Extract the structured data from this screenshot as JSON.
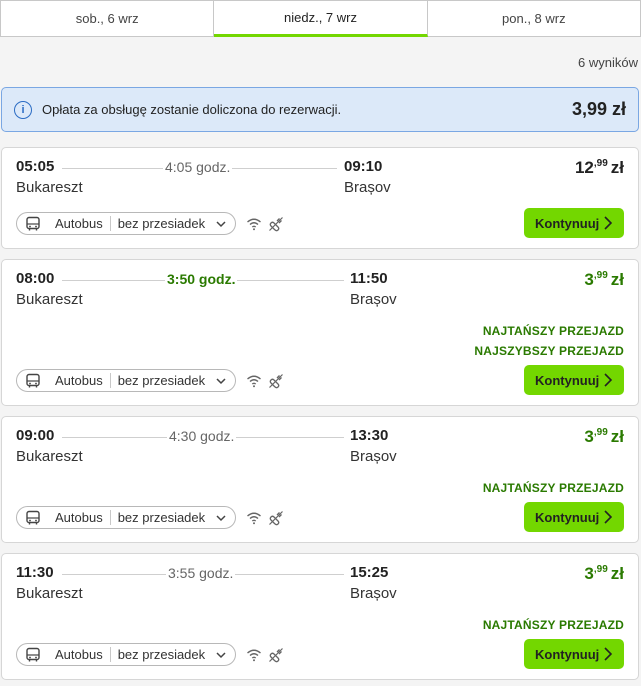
{
  "tabs": [
    {
      "label": "sob., 6 wrz"
    },
    {
      "label": "niedz., 7 wrz"
    },
    {
      "label": "pon., 8 wrz"
    }
  ],
  "results_count": "6 wyników",
  "fee_notice": {
    "text": "Opłata za obsługę zostanie doliczona do rezerwacji.",
    "price": "3,99 zł"
  },
  "rides": [
    {
      "departure_time": "05:05",
      "departure_city": "Bukareszt",
      "duration": "4:05 godz.",
      "arrival_time": "09:10",
      "arrival_city": "Brașov",
      "price_int": "12",
      "price_dec": ",99",
      "currency": "zł",
      "badges": [],
      "transport": "Autobus",
      "transfers": "bez przesiadek",
      "button": "Kontynuuj"
    },
    {
      "departure_time": "08:00",
      "departure_city": "Bukareszt",
      "duration": "3:50 godz.",
      "arrival_time": "11:50",
      "arrival_city": "Brașov",
      "price_int": "3",
      "price_dec": ",99",
      "currency": "zł",
      "badges": [
        "NAJTAŃSZY PRZEJAZD",
        "NAJSZYBSZY PRZEJAZD"
      ],
      "transport": "Autobus",
      "transfers": "bez przesiadek",
      "button": "Kontynuuj"
    },
    {
      "departure_time": "09:00",
      "departure_city": "Bukareszt",
      "duration": "4:30 godz.",
      "arrival_time": "13:30",
      "arrival_city": "Brașov",
      "price_int": "3",
      "price_dec": ",99",
      "currency": "zł",
      "badges": [
        "NAJTAŃSZY PRZEJAZD"
      ],
      "transport": "Autobus",
      "transfers": "bez przesiadek",
      "button": "Kontynuuj"
    },
    {
      "departure_time": "11:30",
      "departure_city": "Bukareszt",
      "duration": "3:55 godz.",
      "arrival_time": "15:25",
      "arrival_city": "Brașov",
      "price_int": "3",
      "price_dec": ",99",
      "currency": "zł",
      "badges": [
        "NAJTAŃSZY PRZEJAZD"
      ],
      "transport": "Autobus",
      "transfers": "bez przesiadek",
      "button": "Kontynuuj"
    }
  ],
  "icons": {
    "info": "info-icon",
    "bus": "bus-icon",
    "chevron": "chevron-down-icon",
    "wifi": "wifi-icon",
    "power": "power-socket-icon",
    "arrow": "chevron-right-icon"
  },
  "colors": {
    "accent": "#73d700",
    "green_text": "#2a7a00",
    "info_bg": "#dce9f9",
    "info_border": "#7aa7e3"
  }
}
